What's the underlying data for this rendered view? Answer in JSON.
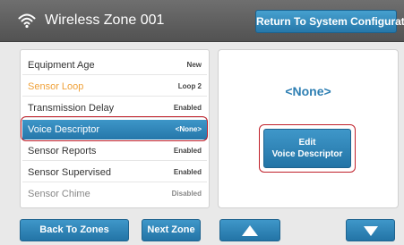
{
  "header": {
    "title": "Wireless Zone 001",
    "return_label": "Return To System Configuration"
  },
  "settings": [
    {
      "label": "Equipment Age",
      "value": "New",
      "state": "normal"
    },
    {
      "label": "Sensor Loop",
      "value": "Loop 2",
      "state": "highlighted"
    },
    {
      "label": "Transmission Delay",
      "value": "Enabled",
      "state": "normal"
    },
    {
      "label": "Voice Descriptor",
      "value": "<None>",
      "state": "selected"
    },
    {
      "label": "Sensor Reports",
      "value": "Enabled",
      "state": "normal"
    },
    {
      "label": "Sensor Supervised",
      "value": "Enabled",
      "state": "normal"
    },
    {
      "label": "Sensor Chime",
      "value": "Disabled",
      "state": "dimmed"
    }
  ],
  "detail": {
    "value": "<None>",
    "edit_line1": "Edit",
    "edit_line2": "Voice Descriptor"
  },
  "footer": {
    "back_label": "Back To Zones",
    "next_label": "Next Zone"
  },
  "icons": {
    "signal": "wifi-icon",
    "scroll_up": "arrow-up-icon",
    "scroll_down": "arrow-down-icon"
  },
  "colors": {
    "accent_blue": "#2e7fb3",
    "highlight_orange": "#f0a23a",
    "callout_red": "#c0202a",
    "header_gray": "#5e5e5e"
  }
}
